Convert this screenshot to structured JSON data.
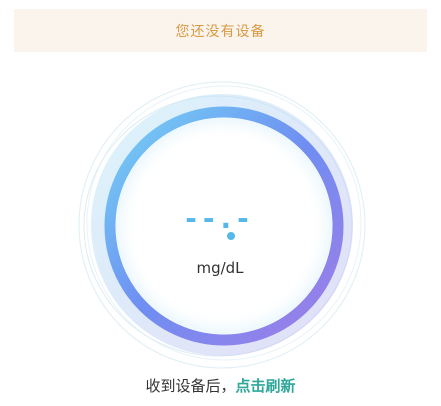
{
  "banner": {
    "message": "您还没有设备"
  },
  "gauge": {
    "value_placeholder": "--.-",
    "unit": "mg/dL"
  },
  "footer": {
    "prompt": "收到设备后，",
    "refresh_link": "点击刷新"
  },
  "colors": {
    "banner_bg": "#fbf4ec",
    "banner_text": "#d99a45",
    "value": "#56b8e8",
    "ring_start": "#6dd0f2",
    "ring_mid": "#6f8ef2",
    "ring_end": "#9a7ce8",
    "refresh_link": "#2fa79a"
  }
}
